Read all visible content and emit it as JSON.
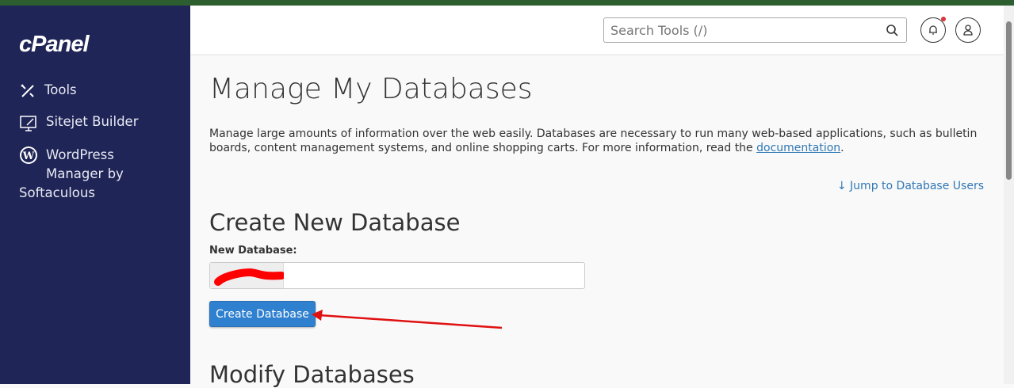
{
  "sidebar": {
    "logo": "cPanel",
    "items": [
      {
        "label": "Tools",
        "icon": "tools-icon"
      },
      {
        "label": "Sitejet Builder",
        "icon": "monitor-pen-icon"
      },
      {
        "label_lines": [
          "WordPress",
          "Manager by",
          "Softaculous"
        ],
        "icon": "wordpress-icon"
      }
    ]
  },
  "header": {
    "search_placeholder": "Search Tools (/)"
  },
  "page": {
    "title": "Manage My Databases",
    "description": "Manage large amounts of information over the web easily. Databases are necessary to run many web-based applications, such as bulletin boards, content management systems, and online shopping carts. For more information, read the ",
    "doc_link": "documentation",
    "period": ".",
    "jump_link": "↓ Jump to Database Users"
  },
  "create": {
    "heading": "Create New Database",
    "label": "New Database:",
    "value": "",
    "button": "Create Database"
  },
  "modify": {
    "heading": "Modify Databases"
  },
  "colors": {
    "sidebar": "#1f2556",
    "accent": "#2f80cf",
    "annotation": "#e01010"
  }
}
